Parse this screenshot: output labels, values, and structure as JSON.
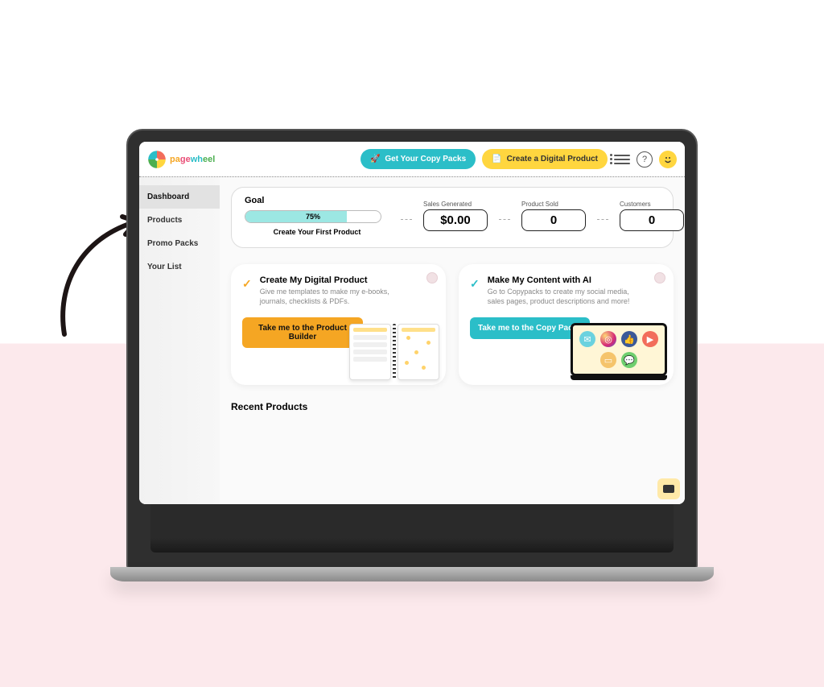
{
  "brand": {
    "name_parts": [
      "pa",
      "ge",
      "wh",
      "eel"
    ]
  },
  "header": {
    "copy_packs_btn": "Get Your Copy Packs",
    "create_product_btn": "Create a Digital Product"
  },
  "sidebar": {
    "items": [
      {
        "label": "Dashboard",
        "active": true
      },
      {
        "label": "Products",
        "active": false
      },
      {
        "label": "Promo Packs",
        "active": false
      },
      {
        "label": "Your List",
        "active": false
      }
    ]
  },
  "goal": {
    "title": "Goal",
    "progress_percent": 75,
    "progress_label": "75%",
    "subtext": "Create Your First Product",
    "stats": [
      {
        "label": "Sales Generated",
        "value": "$0.00"
      },
      {
        "label": "Product Sold",
        "value": "0"
      },
      {
        "label": "Customers",
        "value": "0"
      }
    ]
  },
  "cards": [
    {
      "title": "Create My Digital Product",
      "subtitle": "Give me templates to make my e-books, journals, checklists & PDFs.",
      "cta": "Take me to the Product Builder",
      "accent": "yellow"
    },
    {
      "title": "Make My Content with AI",
      "subtitle": "Go to Copypacks to create my social media, sales pages, product descriptions and more!",
      "cta": "Take me to the Copy Packs",
      "accent": "teal"
    }
  ],
  "recent": {
    "title": "Recent Products"
  }
}
